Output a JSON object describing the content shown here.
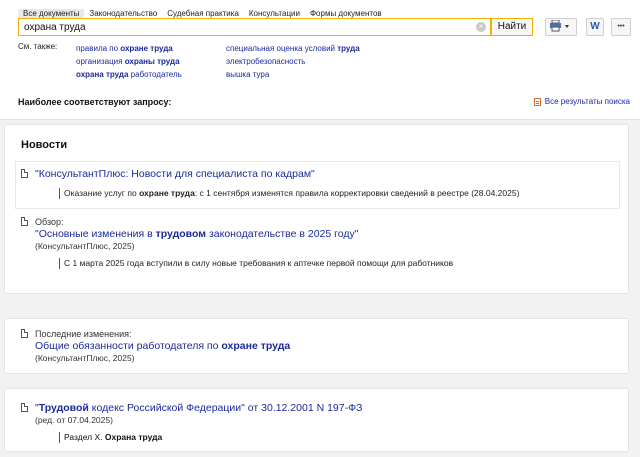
{
  "tabs": [
    "Все документы",
    "Законодательство",
    "Судебная практика",
    "Консультации",
    "Формы документов"
  ],
  "search": {
    "value": "охрана труда",
    "find_label": "Найти",
    "clear_glyph": "×"
  },
  "toolbar": {
    "print_icon": "print-icon",
    "word_label": "W",
    "more_label": "•••"
  },
  "see_also": {
    "label": "См. также:",
    "col1": [
      {
        "pre": "правила по ",
        "bold": "охране труда",
        "post": ""
      },
      {
        "pre": "организация ",
        "bold": "охраны труда",
        "post": ""
      },
      {
        "pre": "",
        "bold": "охрана труда",
        "post": " работодатель"
      }
    ],
    "col2": [
      {
        "pre": "специальная оценка условий ",
        "bold": "труда",
        "post": ""
      },
      {
        "pre": "электробезопасность",
        "bold": "",
        "post": ""
      },
      {
        "pre": "вышка тура",
        "bold": "",
        "post": ""
      }
    ]
  },
  "best_match": "Наиболее соответствуют запросу:",
  "all_results": "Все результаты поиска",
  "news": {
    "title": "Новости",
    "item1": {
      "link": "\"КонсультантПлюс: Новости для специалиста по кадрам\"",
      "snippet_pre": "Оказание услуг по ",
      "snippet_bold": "охране труда",
      "snippet_post": ": с 1 сентября изменятся правила корректировки сведений в реестре (28.04.2025)"
    },
    "item2": {
      "label": "Обзор:",
      "link_pre": "\"Основные изменения в ",
      "link_bold": "трудовом",
      "link_post": " законодательстве в 2025 году\"",
      "source": "(КонсультантПлюс, 2025)",
      "snippet": "С 1 марта 2025 года вступили в силу новые требования к аптечке первой помощи для работников"
    }
  },
  "changes": {
    "label": "Последние изменения:",
    "link_pre": "Общие обязанности работодателя по ",
    "link_bold": "охране труда",
    "source": "(КонсультантПлюс, 2025)"
  },
  "code": {
    "link_pre": "\"",
    "link_bold": "Трудовой",
    "link_post": " кодекс Российской Федерации\" от 30.12.2001 N 197-ФЗ",
    "edition": "(ред. от 07.04.2025)",
    "section_pre": "Раздел X. ",
    "section_bold": "Охрана труда"
  }
}
